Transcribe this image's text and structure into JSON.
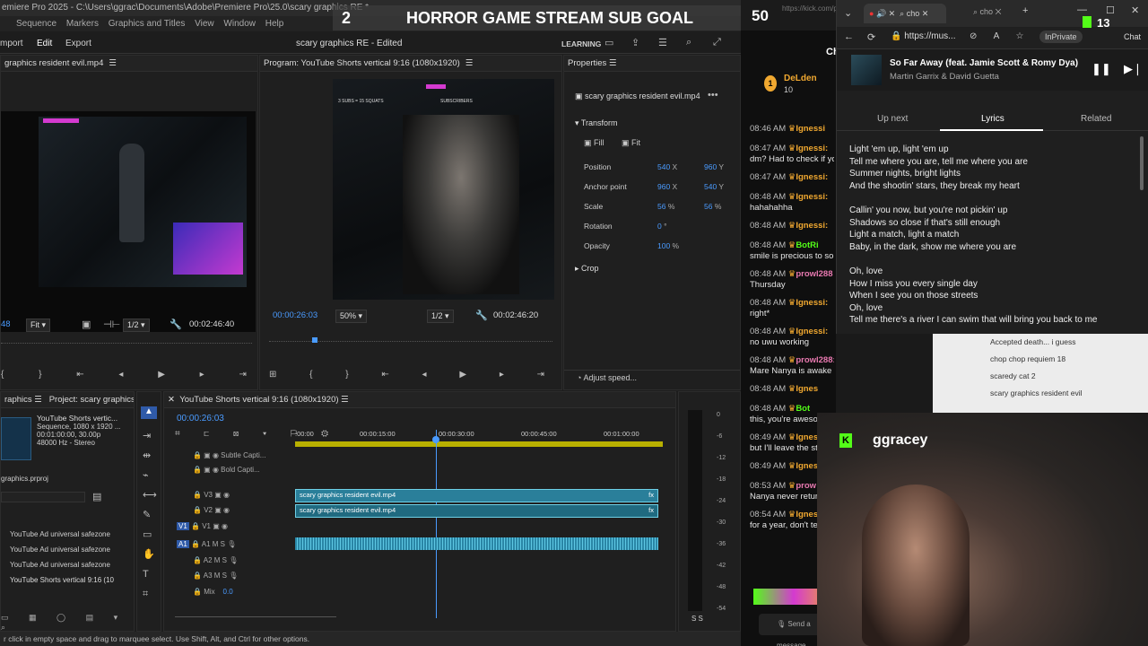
{
  "premiere": {
    "title": "emiere Pro 2025 - C:\\Users\\ggrac\\Documents\\Adobe\\Premiere Pro\\25.0\\scary graphics RE *",
    "menu": [
      "Sequence",
      "Markers",
      "Graphics and Titles",
      "View",
      "Window",
      "Help"
    ],
    "workspace_tabs": {
      "import": "mport",
      "edit": "Edit",
      "export": "Export"
    },
    "doc_title": "scary graphics RE - Edited",
    "learning": "LEARNING",
    "source_tab": "graphics resident evil.mp4",
    "program_tab": "Program: YouTube Shorts vertical 9:16 (1080x1920)",
    "source_fit": "Fit",
    "source_res": "1/2",
    "source_tc": "00:02:46:40",
    "source_left_tc": "48",
    "program_tc": "00:00:26:03",
    "program_zoom": "50%",
    "program_res": "1/2",
    "program_dur": "00:02:46:20",
    "properties": {
      "header": "Properties",
      "clip": "scary graphics resident evil.mp4",
      "transform": "Transform",
      "fill": "Fill",
      "fit": "Fit",
      "rows": [
        {
          "name": "Position",
          "v1": "540",
          "u1": "X",
          "v2": "960",
          "u2": "Y"
        },
        {
          "name": "Anchor point",
          "v1": "960",
          "u1": "X",
          "v2": "540",
          "u2": "Y"
        },
        {
          "name": "Scale",
          "v1": "56",
          "u1": "%",
          "v2": "56",
          "u2": "%"
        },
        {
          "name": "Rotation",
          "v1": "0",
          "u1": "°",
          "v2": "",
          "u2": ""
        },
        {
          "name": "Opacity",
          "v1": "100",
          "u1": "%",
          "v2": "",
          "u2": ""
        }
      ],
      "crop": "Crop",
      "adjust_speed": "Adjust speed..."
    },
    "project": {
      "tab1": "raphics",
      "tab2": "Project: scary graphics",
      "seq_name": "YouTube Shorts vertic...",
      "seq_info1": "Sequence, 1080 x 1920 ...",
      "seq_info2": "00:01:00:00, 30.00p",
      "seq_info3": "48000 Hz - Stereo",
      "file": "graphics.prproj",
      "items": [
        "YouTube Ad universal safezone",
        "YouTube Ad universal safezone",
        "YouTube Ad universal safezone",
        "YouTube Shorts vertical 9:16 (10"
      ]
    },
    "timeline": {
      "tab": "YouTube Shorts vertical 9:16 (1080x1920)",
      "tc": "00:00:26:03",
      "ruler": [
        ":00:00",
        "00:00:15:00",
        "00:00:30:00",
        "00:00:45:00",
        "00:01:00:00"
      ],
      "caption1": "Subtle Capti...",
      "caption2": "Bold Capti...",
      "tracks": [
        "V3",
        "V2",
        "V1",
        "A1",
        "A2",
        "A3"
      ],
      "mix": "Mix",
      "mix_val": "0.0",
      "clip1": "scary graphics resident evil.mp4",
      "clip2": "scary graphics resident evil.mp4",
      "db": [
        "0",
        "-6",
        "-12",
        "-18",
        "-24",
        "-30",
        "-36",
        "-42",
        "-48",
        "-54"
      ],
      "meter_s": "S S"
    },
    "status": "r click in empty space and drag to marquee select. Use Shift, Alt, and Ctrl for other options."
  },
  "overlay": {
    "count": "2",
    "text": "HORROR GAME STREAM SUB GOAL",
    "goal": "50"
  },
  "kick": {
    "url": "https://kick.com/popout/gg",
    "header": "Ch",
    "top_name": "DeLden",
    "top_rank": "1",
    "top_count": "10",
    "messages": [
      {
        "t": "08:46 AM",
        "n": "Ignessi",
        "c": "#f0a830",
        "m": ""
      },
      {
        "t": "08:47 AM",
        "n": "Ignessi:",
        "c": "#f0a830",
        "m": "dm? Had to check if yo im planning on getting"
      },
      {
        "t": "08:47 AM",
        "n": "Ignessi:",
        "c": "#f0a830",
        "m": ""
      },
      {
        "t": "08:48 AM",
        "n": "Ignessi:",
        "c": "#f0a830",
        "m": "hahahahha"
      },
      {
        "t": "08:48 AM",
        "n": "Ignessi:",
        "c": "#f0a830",
        "m": ""
      },
      {
        "t": "08:48 AM",
        "n": "BotRi",
        "c": "#53fc18",
        "m": "smile is precious to so smiling"
      },
      {
        "t": "08:48 AM",
        "n": "prowl288",
        "c": "#e879b0",
        "m": "Thursday"
      },
      {
        "t": "08:48 AM",
        "n": "Ignessi:",
        "c": "#f0a830",
        "m": "right*"
      },
      {
        "t": "08:48 AM",
        "n": "Ignessi:",
        "c": "#f0a830",
        "m": "no uwu working"
      },
      {
        "t": "08:48 AM",
        "n": "prowl288:",
        "c": "#e879b0",
        "m": "Mare Nanya is awake"
      },
      {
        "t": "08:48 AM",
        "n": "Ignes",
        "c": "#f0a830",
        "m": ""
      },
      {
        "t": "08:48 AM",
        "n": "Bot",
        "c": "#53fc18",
        "m": "this, you're awesom"
      },
      {
        "t": "08:49 AM",
        "n": "Ignes",
        "c": "#f0a830",
        "m": "but I'll leave the st"
      },
      {
        "t": "08:49 AM",
        "n": "Ignes",
        "c": "#f0a830",
        "m": ""
      },
      {
        "t": "08:53 AM",
        "n": "prow",
        "c": "#e879b0",
        "m": "Nanya never retur"
      },
      {
        "t": "08:54 AM",
        "n": "Ignes",
        "c": "#f0a830",
        "m": "for a year, don't te"
      }
    ],
    "send": "Send a message"
  },
  "browser": {
    "tab1": "cho",
    "tab2": "cho",
    "url": "https://mus...",
    "inprivate": "InPrivate",
    "chat": "Chat",
    "song": "So Far Away (feat. Jamie Scott & Romy Dya)",
    "artist": "Martin Garrix & David Guetta",
    "tabs": [
      "Up next",
      "Lyrics",
      "Related"
    ],
    "lyrics": [
      "Light 'em up, light 'em up",
      "Tell me where you are, tell me where you are",
      "Summer nights, bright lights",
      "And the shootin' stars, they break my heart",
      "",
      "Callin' you now, but you're not pickin' up",
      "Shadows so close if that's still enough",
      "Light a match, light a match",
      "Baby, in the dark, show me where you are",
      "",
      "Oh, love",
      "How I miss you every single day",
      "When I see you on those streets",
      "Oh, love",
      "Tell me there's a river I can swim that will bring you back to me"
    ],
    "kick_count": "13"
  },
  "playlist": [
    "Accepted death... i guess",
    "chop chop requiem 18",
    "scaredy cat 2",
    "scary graphics resident evil",
    "scary graphics"
  ],
  "webcam": {
    "name": "ggracey"
  },
  "colors": {
    "accent": "#4a9bff",
    "kick": "#53fc18",
    "clip": "#2a7f9a"
  }
}
